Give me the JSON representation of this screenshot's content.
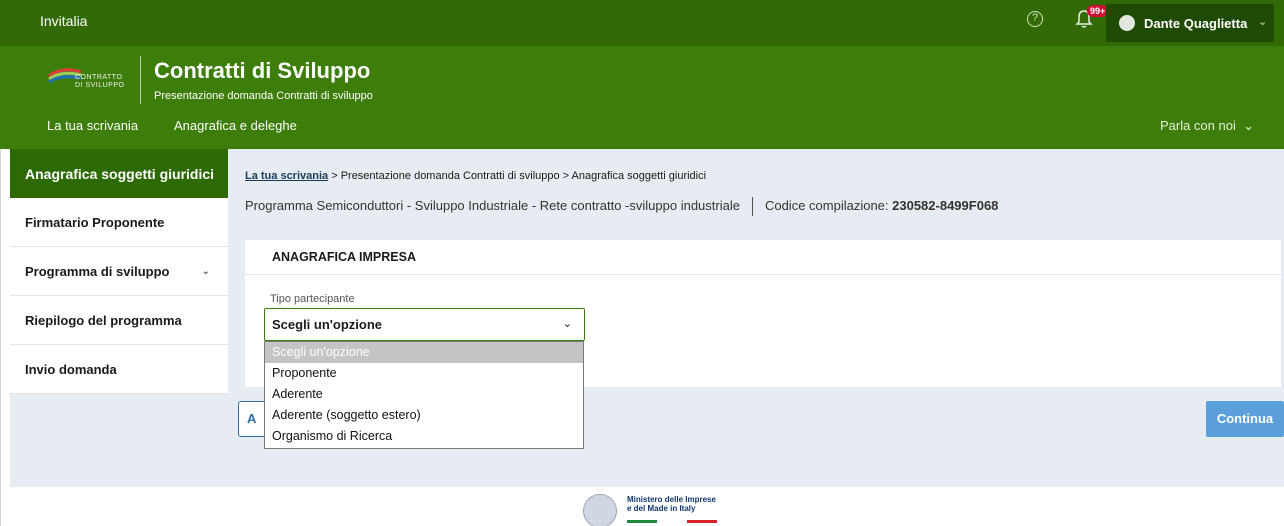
{
  "topbar": {
    "brand": "Invitalia",
    "help_glyph": "?",
    "notifications_badge": "99+",
    "user_name": "Dante Quaglietta"
  },
  "header": {
    "logo_text_1": "CONTRATTO",
    "logo_text_2": "DI SVILUPPO",
    "title": "Contratti di Sviluppo",
    "subtitle": "Presentazione domanda Contratti di sviluppo",
    "nav": [
      "La tua scrivania",
      "Anagrafica e deleghe"
    ],
    "parla": "Parla con noi"
  },
  "sidebar": {
    "items": [
      {
        "label": "Anagrafica soggetti giuridici",
        "active": true
      },
      {
        "label": "Firmatario Proponente"
      },
      {
        "label": "Programma di sviluppo",
        "has_chevron": true
      },
      {
        "label": "Riepilogo del programma"
      },
      {
        "label": "Invio domanda"
      }
    ]
  },
  "breadcrumb": {
    "link": "La tua scrivania",
    "rest": " > Presentazione domanda Contratti di sviluppo  > Anagrafica soggetti giuridici"
  },
  "program": {
    "text": "Programma Semiconduttori - Sviluppo Industriale   -  Rete contratto -sviluppo industriale",
    "code_label": "Codice compilazione: ",
    "code_value": "230582-8499F068"
  },
  "form": {
    "section_title": "ANAGRAFICA IMPRESA",
    "field_label": "Tipo partecipante",
    "selected": "Scegli un'opzione",
    "options": [
      "Scegli un'opzione",
      "Proponente",
      "Aderente",
      "Aderente (soggetto estero)",
      "Organismo di Ricerca"
    ]
  },
  "buttons": {
    "back_partial": "A",
    "continue": "Continua"
  },
  "footer": {
    "ministry_line1": "Ministero delle Imprese",
    "ministry_line2": "e del Made in Italy"
  },
  "colors": {
    "topbar": "#326b05",
    "header": "#3d7d0a",
    "active_sidebar": "#2e6a03",
    "continue_button": "#5b9fdb"
  }
}
